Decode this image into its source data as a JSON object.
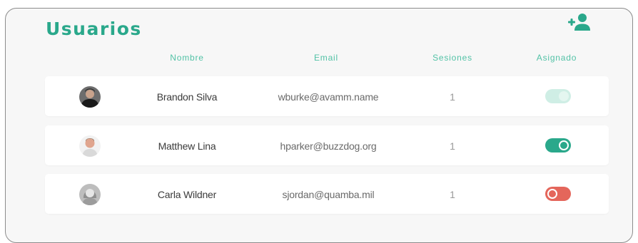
{
  "header": {
    "title": "Usuarios",
    "add_icon": "add-user-icon"
  },
  "columns": {
    "name": "Nombre",
    "email": "Email",
    "sessions": "Sesiones",
    "assigned": "Asignado"
  },
  "rows": [
    {
      "name": "Brandon Silva",
      "email": "wburke@avamm.name",
      "sessions": "1",
      "assigned": true,
      "toggle_state": "disabled",
      "toggle_color": "#cfeee5",
      "knob_color": "#e4f6f0"
    },
    {
      "name": "Matthew Lina",
      "email": "hparker@buzzdog.org",
      "sessions": "1",
      "assigned": true,
      "toggle_state": "on",
      "toggle_color": "#2aa88b",
      "knob_color": "#ffffff"
    },
    {
      "name": "Carla Wildner",
      "email": "sjordan@quamba.mil",
      "sessions": "1",
      "assigned": false,
      "toggle_state": "off",
      "toggle_color": "#e4665b",
      "knob_color": "#ffffff"
    }
  ],
  "colors": {
    "accent": "#2aa88b",
    "danger": "#e4665b"
  }
}
